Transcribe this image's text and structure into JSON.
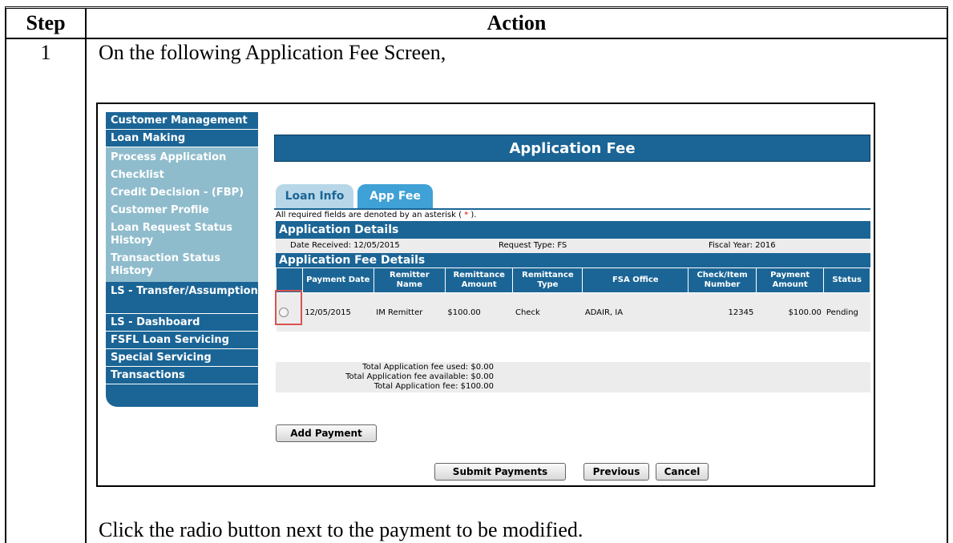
{
  "doc": {
    "header_step": "Step",
    "header_action": "Action",
    "step_number": "1",
    "intro": "On the following Application Fee Screen,",
    "instruction": "Click the radio button next to the payment to be modified."
  },
  "nav": {
    "items_top": [
      "Customer Management",
      "Loan Making"
    ],
    "sub_items": [
      "Process Application",
      "Checklist",
      "Credit Decision - (FBP)",
      "Customer Profile",
      "Loan Request Status History",
      "Transaction Status History"
    ],
    "items_bottom": [
      "LS - Transfer/Assumption",
      "LS - Dashboard",
      "FSFL Loan Servicing",
      "Special Servicing",
      "Transactions"
    ]
  },
  "page": {
    "title": "Application Fee",
    "tabs": [
      "Loan Info",
      "App Fee"
    ],
    "required_note_prefix": "All required fields are denoted by an asterisk (",
    "required_asterisk": "*",
    "required_note_suffix": ").",
    "section1": "Application Details",
    "date_received": "Date Received:  12/05/2015",
    "request_type": "Request Type:  FS",
    "fiscal_year": "Fiscal Year:  2016",
    "section2": "Application Fee Details"
  },
  "fee_table": {
    "headers": [
      "Payment Date",
      "Remitter Name",
      "Remittance Amount",
      "Remittance Type",
      "FSA Office",
      "Check/Item Number",
      "Payment Amount",
      "Status"
    ],
    "row": [
      "12/05/2015",
      "IM Remitter",
      "$100.00",
      "Check",
      "ADAIR, IA",
      "12345",
      "$100.00",
      "Pending"
    ]
  },
  "totals": {
    "used": "Total Application fee used: $0.00",
    "available": "Total Application fee available: $0.00",
    "total": "Total Application fee: $100.00"
  },
  "buttons": {
    "add_payment": "Add Payment",
    "submit": "Submit Payments",
    "previous": "Previous",
    "cancel": "Cancel"
  },
  "colors": {
    "navy": "#1b6596",
    "nav_sub": "#8fbccc",
    "highlight": "#d9534f"
  }
}
